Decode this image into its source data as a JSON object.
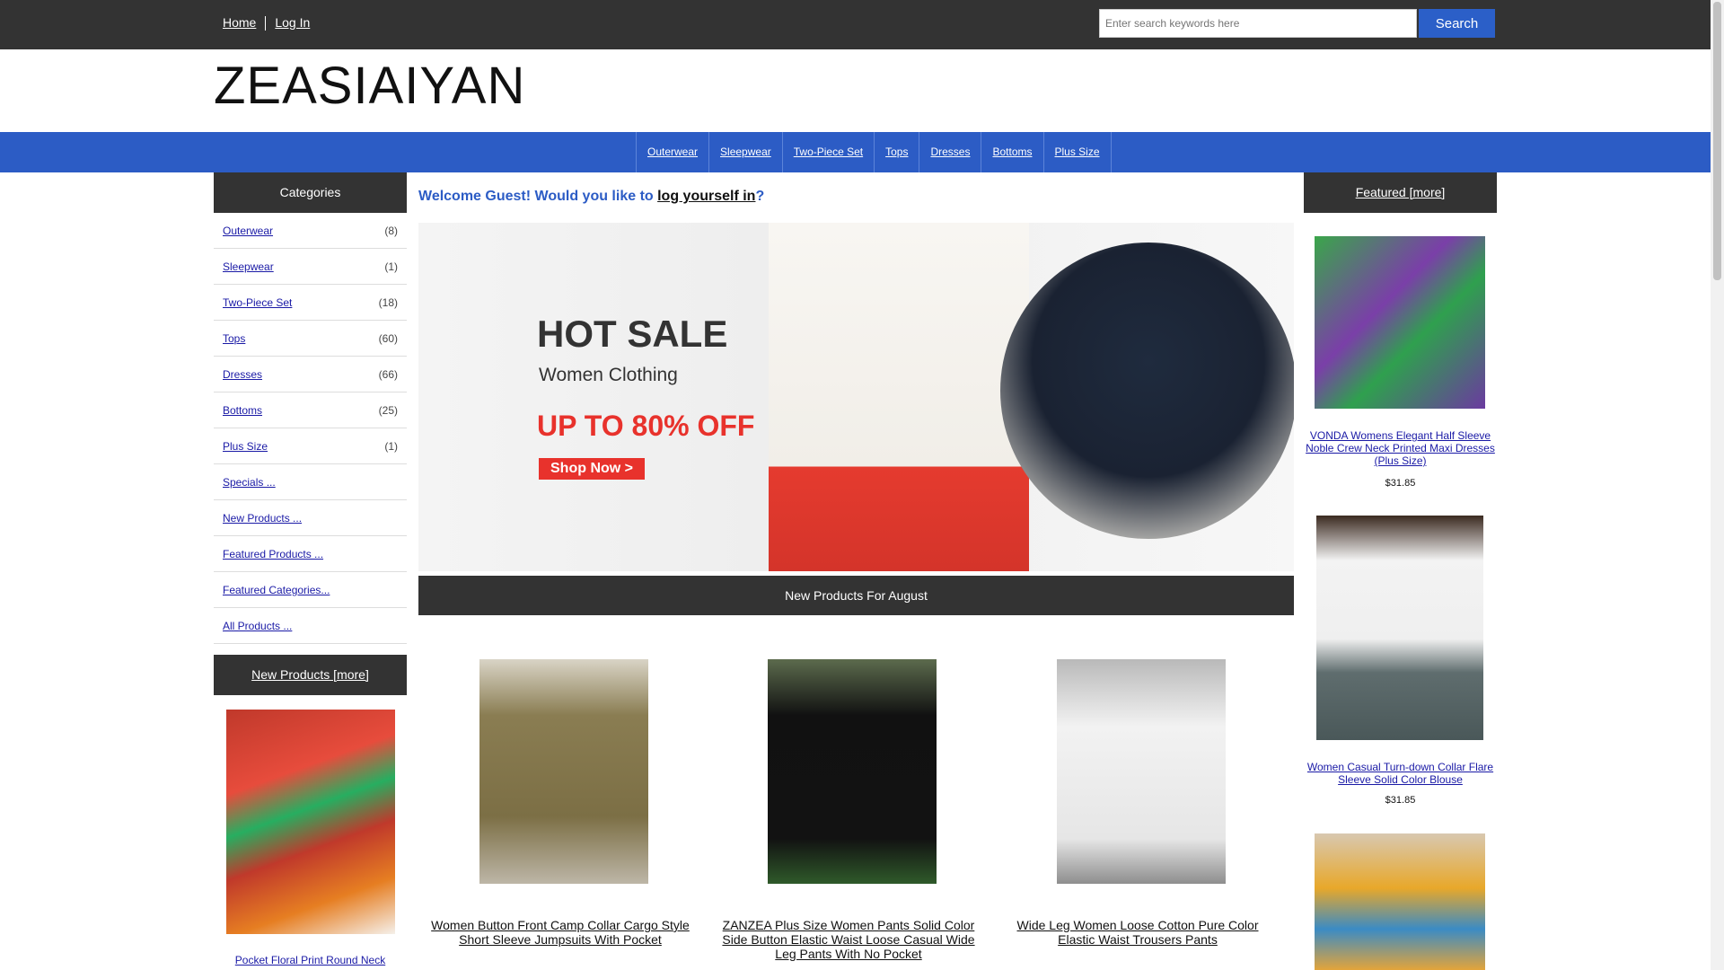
{
  "header": {
    "home": "Home",
    "login": "Log In",
    "search_placeholder": "Enter search keywords here",
    "search_button": "Search"
  },
  "logo": "ZEASIAIYAN",
  "nav": [
    "Outerwear",
    "Sleepwear",
    "Two-Piece Set",
    "Tops",
    "Dresses",
    "Bottoms",
    "Plus Size"
  ],
  "categories": {
    "title": "Categories",
    "items": [
      {
        "label": "Outerwear",
        "count": "(8)"
      },
      {
        "label": "Sleepwear",
        "count": "(1)"
      },
      {
        "label": "Two-Piece Set",
        "count": "(18)"
      },
      {
        "label": "Tops",
        "count": "(60)"
      },
      {
        "label": "Dresses",
        "count": "(66)"
      },
      {
        "label": "Bottoms",
        "count": "(25)"
      },
      {
        "label": "Plus Size",
        "count": "(1)"
      },
      {
        "label": "Specials ...",
        "count": ""
      },
      {
        "label": "New Products ...",
        "count": ""
      },
      {
        "label": "Featured Products ...",
        "count": ""
      },
      {
        "label": "Featured Categories...",
        "count": ""
      },
      {
        "label": "All Products ...",
        "count": ""
      }
    ]
  },
  "left_new": {
    "title": "New Products  [more]",
    "item": "Pocket Floral Print Round Neck"
  },
  "welcome": {
    "prefix": "Welcome Guest! Would you like to ",
    "link": "log yourself in",
    "suffix": "?"
  },
  "banner": {
    "hot": "HOT SALE",
    "women": "Women Clothing",
    "off": "UP TO 80% OFF",
    "shop": "Shop Now >"
  },
  "new_for_month": "New Products For August",
  "products": [
    "Women Button Front Camp Collar Cargo Style Short Sleeve Jumpsuits With Pocket",
    "ZANZEA Plus Size Women Pants Solid Color Side Button Elastic Waist Loose Casual Wide Leg Pants With No Pocket",
    "Wide Leg Women Loose Cotton Pure Color Elastic Waist Trousers Pants"
  ],
  "featured": {
    "title": "Featured  [more]",
    "items": [
      {
        "name": "VONDA Womens Elegant Half Sleeve Noble Crew Neck Printed Maxi Dresses (Plus Size)",
        "price": "$31.85"
      },
      {
        "name": "Women Casual Turn-down Collar Flare Sleeve Solid Color Blouse",
        "price": "$31.85"
      }
    ]
  }
}
